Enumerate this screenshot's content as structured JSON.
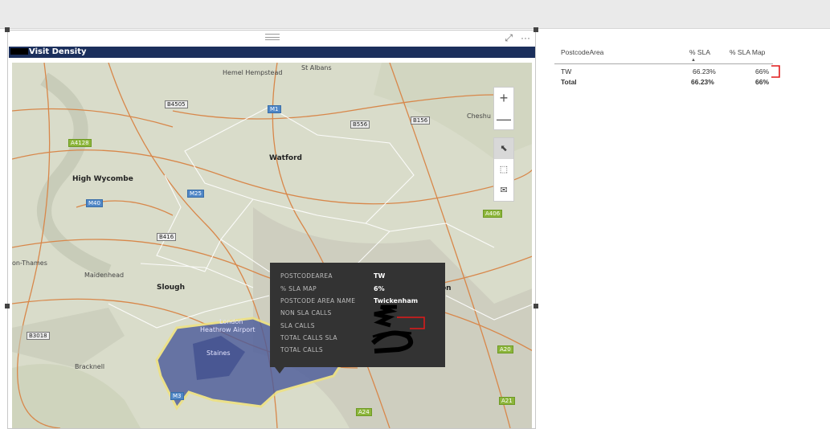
{
  "visual": {
    "title": "Visit Density",
    "icons": {
      "focus": "focus-mode-icon",
      "more": "more-options-icon"
    }
  },
  "map": {
    "labels": {
      "hemel": "Hemel Hempstead",
      "stalbans": "St Albans",
      "watford": "Watford",
      "highwycombe": "High Wycombe",
      "maidenhead": "Maidenhead",
      "slough": "Slough",
      "heathrow": "Heathrow Airport",
      "staines": "Staines",
      "bracknell": "Bracknell",
      "onthames": "on-Thames",
      "london": "London",
      "cheshunt": "Cheshu",
      "don": "on"
    },
    "roads": [
      "B4505",
      "M1",
      "B556",
      "B156",
      "A4128",
      "M25",
      "M40",
      "A406",
      "B416",
      "B3018",
      "A20",
      "M3",
      "A24",
      "A21"
    ],
    "controls": {
      "zoom_in": "+",
      "zoom_out": "—"
    }
  },
  "tooltip": {
    "rows": [
      {
        "label": "POSTCODEAREA",
        "value": "TW"
      },
      {
        "label": "% SLA MAP",
        "value": "6%"
      },
      {
        "label": "POSTCODE AREA NAME",
        "value": "Twickenham"
      },
      {
        "label": "NON SLA CALLS",
        "value": ""
      },
      {
        "label": "SLA CALLS",
        "value": ""
      },
      {
        "label": "TOTAL CALLS SLA",
        "value": ""
      },
      {
        "label": "TOTAL CALLS",
        "value": ""
      }
    ]
  },
  "table": {
    "headers": [
      "PostcodeArea",
      "% SLA",
      "% SLA Map"
    ],
    "rows": [
      {
        "area": "TW",
        "sla": "66.23%",
        "sla_map": "66%"
      }
    ],
    "total": {
      "label": "Total",
      "sla": "66.23%",
      "sla_map": "66%"
    }
  },
  "colors": {
    "title_bar": "#1b2f5c",
    "highlight_region": "#4a5a9a",
    "annotation": "#e11a1a"
  }
}
